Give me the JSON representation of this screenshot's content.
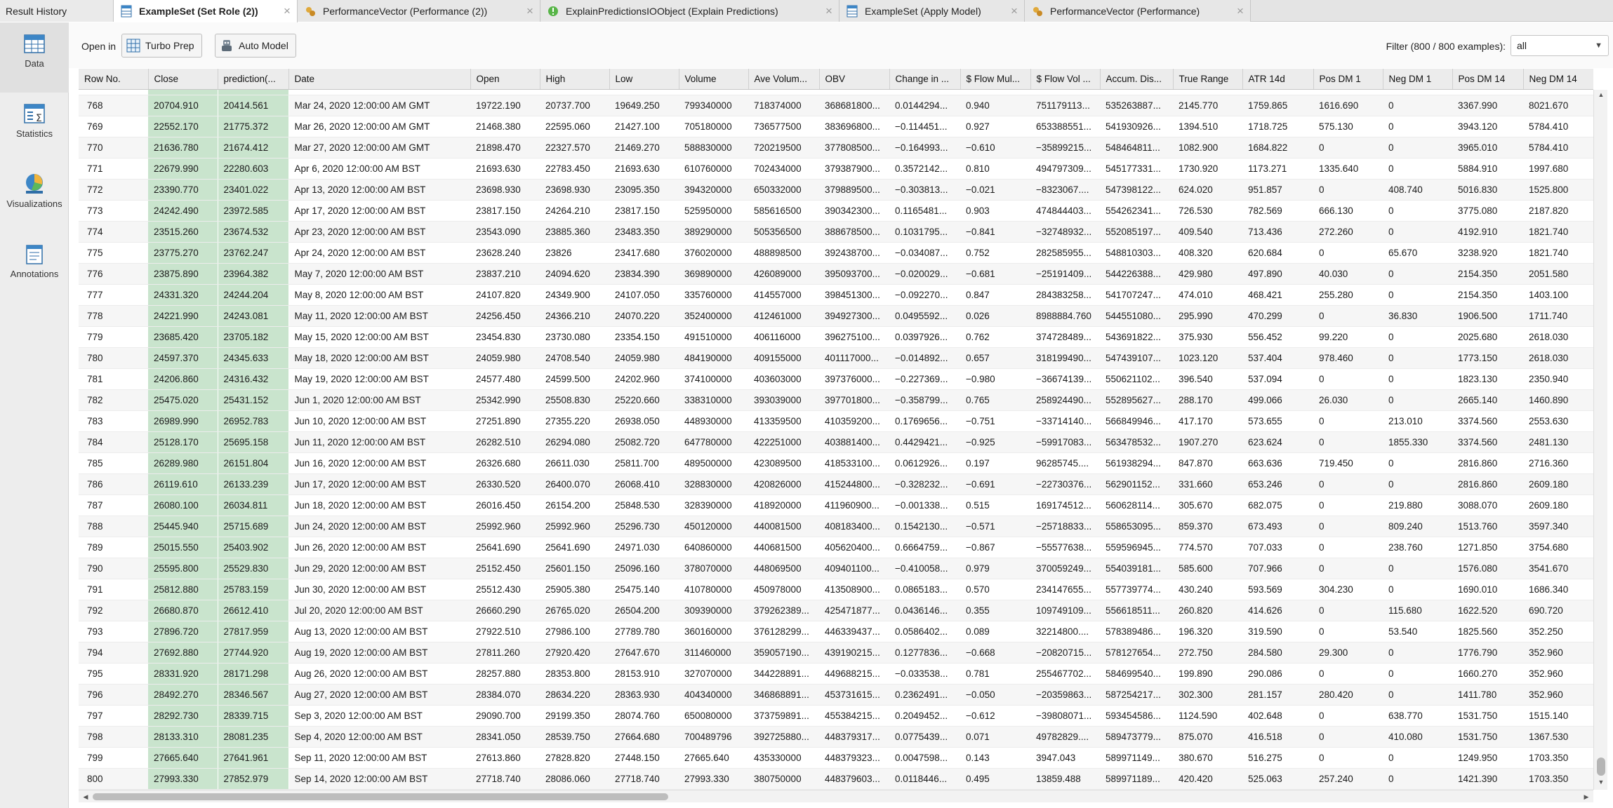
{
  "tabs": {
    "result_history": "Result History",
    "items": [
      {
        "label": "ExampleSet (Set Role (2))",
        "active": true,
        "icon": "exampleset-icon"
      },
      {
        "label": "PerformanceVector (Performance (2))",
        "active": false,
        "icon": "performance-icon"
      },
      {
        "label": "ExplainPredictionsIOObject (Explain Predictions)",
        "active": false,
        "icon": "explain-icon"
      },
      {
        "label": "ExampleSet (Apply Model)",
        "active": false,
        "icon": "exampleset-icon"
      },
      {
        "label": "PerformanceVector (Performance)",
        "active": false,
        "icon": "performance-icon"
      }
    ],
    "close_glyph": "×"
  },
  "nav": {
    "data": "Data",
    "statistics": "Statistics",
    "visualizations": "Visualizations",
    "annotations": "Annotations"
  },
  "toolbar": {
    "open_in": "Open in",
    "turbo_prep": "Turbo Prep",
    "auto_model": "Auto Model",
    "filter_label": "Filter (800 / 800 examples):",
    "filter_value": "all"
  },
  "table": {
    "columns": [
      "Row No.",
      "Close",
      "prediction(...",
      "Date",
      "Open",
      "High",
      "Low",
      "Volume",
      "Ave Volum...",
      "OBV",
      "Change in ...",
      "$ Flow Mul...",
      "$ Flow Vol ...",
      "Accum. Dis...",
      "True Range",
      "ATR 14d",
      "Pos DM 1",
      "Neg DM 1",
      "Pos DM 14",
      "Neg DM 14"
    ],
    "rows": [
      [
        "768",
        "20704.910",
        "20414.561",
        "Mar 24, 2020 12:00:00 AM GMT",
        "19722.190",
        "20737.700",
        "19649.250",
        "799340000",
        "718374000",
        "368681800...",
        "0.0144294...",
        "0.940",
        "751179113...",
        "535263887...",
        "2145.770",
        "1759.865",
        "1616.690",
        "0",
        "3367.990",
        "8021.670"
      ],
      [
        "769",
        "22552.170",
        "21775.372",
        "Mar 26, 2020 12:00:00 AM GMT",
        "21468.380",
        "22595.060",
        "21427.100",
        "705180000",
        "736577500",
        "383696800...",
        "−0.114451...",
        "0.927",
        "653388551...",
        "541930926...",
        "1394.510",
        "1718.725",
        "575.130",
        "0",
        "3943.120",
        "5784.410"
      ],
      [
        "770",
        "21636.780",
        "21674.412",
        "Mar 27, 2020 12:00:00 AM GMT",
        "21898.470",
        "22327.570",
        "21469.270",
        "588830000",
        "720219500",
        "377808500...",
        "−0.164993...",
        "−0.610",
        "−35899215...",
        "548464811...",
        "1082.900",
        "1684.822",
        "0",
        "0",
        "3965.010",
        "5784.410"
      ],
      [
        "771",
        "22679.990",
        "22280.603",
        "Apr 6, 2020 12:00:00 AM BST",
        "21693.630",
        "22783.450",
        "21693.630",
        "610760000",
        "702434000",
        "379387900...",
        "0.3572142...",
        "0.810",
        "494797309...",
        "545177331...",
        "1730.920",
        "1173.271",
        "1335.640",
        "0",
        "5884.910",
        "1997.680"
      ],
      [
        "772",
        "23390.770",
        "23401.022",
        "Apr 13, 2020 12:00:00 AM BST",
        "23698.930",
        "23698.930",
        "23095.350",
        "394320000",
        "650332000",
        "379889500...",
        "−0.303813...",
        "−0.021",
        "−8323067....",
        "547398122...",
        "624.020",
        "951.857",
        "0",
        "408.740",
        "5016.830",
        "1525.800"
      ],
      [
        "773",
        "24242.490",
        "23972.585",
        "Apr 17, 2020 12:00:00 AM BST",
        "23817.150",
        "24264.210",
        "23817.150",
        "525950000",
        "585616500",
        "390342300...",
        "0.1165481...",
        "0.903",
        "474844403...",
        "554262341...",
        "726.530",
        "782.569",
        "666.130",
        "0",
        "3775.080",
        "2187.820"
      ],
      [
        "774",
        "23515.260",
        "23674.532",
        "Apr 23, 2020 12:00:00 AM BST",
        "23543.090",
        "23885.360",
        "23483.350",
        "389290000",
        "505356500",
        "388678500...",
        "0.1031795...",
        "−0.841",
        "−32748932...",
        "552085197...",
        "409.540",
        "713.436",
        "272.260",
        "0",
        "4192.910",
        "1821.740"
      ],
      [
        "775",
        "23775.270",
        "23762.247",
        "Apr 24, 2020 12:00:00 AM BST",
        "23628.240",
        "23826",
        "23417.680",
        "376020000",
        "488898500",
        "392438700...",
        "−0.034087...",
        "0.752",
        "282585955...",
        "548810303...",
        "408.320",
        "620.684",
        "0",
        "65.670",
        "3238.920",
        "1821.740"
      ],
      [
        "776",
        "23875.890",
        "23964.382",
        "May 7, 2020 12:00:00 AM BST",
        "23837.210",
        "24094.620",
        "23834.390",
        "369890000",
        "426089000",
        "395093700...",
        "−0.020029...",
        "−0.681",
        "−25191409...",
        "544226388...",
        "429.980",
        "497.890",
        "40.030",
        "0",
        "2154.350",
        "2051.580"
      ],
      [
        "777",
        "24331.320",
        "24244.204",
        "May 8, 2020 12:00:00 AM BST",
        "24107.820",
        "24349.900",
        "24107.050",
        "335760000",
        "414557000",
        "398451300...",
        "−0.092270...",
        "0.847",
        "284383258...",
        "541707247...",
        "474.010",
        "468.421",
        "255.280",
        "0",
        "2154.350",
        "1403.100"
      ],
      [
        "778",
        "24221.990",
        "24243.081",
        "May 11, 2020 12:00:00 AM BST",
        "24256.450",
        "24366.210",
        "24070.220",
        "352400000",
        "412461000",
        "394927300...",
        "0.0495592...",
        "0.026",
        "8988884.760",
        "544551080...",
        "295.990",
        "470.299",
        "0",
        "36.830",
        "1906.500",
        "1711.740"
      ],
      [
        "779",
        "23685.420",
        "23705.182",
        "May 15, 2020 12:00:00 AM BST",
        "23454.830",
        "23730.080",
        "23354.150",
        "491510000",
        "406116000",
        "396275100...",
        "0.0397926...",
        "0.762",
        "374728489...",
        "543691822...",
        "375.930",
        "556.452",
        "99.220",
        "0",
        "2025.680",
        "2618.030"
      ],
      [
        "780",
        "24597.370",
        "24345.633",
        "May 18, 2020 12:00:00 AM BST",
        "24059.980",
        "24708.540",
        "24059.980",
        "484190000",
        "409155000",
        "401117000...",
        "−0.014892...",
        "0.657",
        "318199490...",
        "547439107...",
        "1023.120",
        "537.404",
        "978.460",
        "0",
        "1773.150",
        "2618.030"
      ],
      [
        "781",
        "24206.860",
        "24316.432",
        "May 19, 2020 12:00:00 AM BST",
        "24577.480",
        "24599.500",
        "24202.960",
        "374100000",
        "403603000",
        "397376000...",
        "−0.227369...",
        "−0.980",
        "−36674139...",
        "550621102...",
        "396.540",
        "537.094",
        "0",
        "0",
        "1823.130",
        "2350.940"
      ],
      [
        "782",
        "25475.020",
        "25431.152",
        "Jun 1, 2020 12:00:00 AM BST",
        "25342.990",
        "25508.830",
        "25220.660",
        "338310000",
        "393039000",
        "397701800...",
        "−0.358799...",
        "0.765",
        "258924490...",
        "552895627...",
        "288.170",
        "499.066",
        "26.030",
        "0",
        "2665.140",
        "1460.890"
      ],
      [
        "783",
        "26989.990",
        "26952.783",
        "Jun 10, 2020 12:00:00 AM BST",
        "27251.890",
        "27355.220",
        "26938.050",
        "448930000",
        "413359500",
        "410359200...",
        "0.1769656...",
        "−0.751",
        "−33714140...",
        "566849946...",
        "417.170",
        "573.655",
        "0",
        "213.010",
        "3374.560",
        "2553.630"
      ],
      [
        "784",
        "25128.170",
        "25695.158",
        "Jun 11, 2020 12:00:00 AM BST",
        "26282.510",
        "26294.080",
        "25082.720",
        "647780000",
        "422251000",
        "403881400...",
        "0.4429421...",
        "−0.925",
        "−59917083...",
        "563478532...",
        "1907.270",
        "623.624",
        "0",
        "1855.330",
        "3374.560",
        "2481.130"
      ],
      [
        "785",
        "26289.980",
        "26151.804",
        "Jun 16, 2020 12:00:00 AM BST",
        "26326.680",
        "26611.030",
        "25811.700",
        "489500000",
        "423089500",
        "418533100...",
        "0.0612926...",
        "0.197",
        "96285745....",
        "561938294...",
        "847.870",
        "663.636",
        "719.450",
        "0",
        "2816.860",
        "2716.360"
      ],
      [
        "786",
        "26119.610",
        "26133.239",
        "Jun 17, 2020 12:00:00 AM BST",
        "26330.520",
        "26400.070",
        "26068.410",
        "328830000",
        "420826000",
        "415244800...",
        "−0.328232...",
        "−0.691",
        "−22730376...",
        "562901152...",
        "331.660",
        "653.246",
        "0",
        "0",
        "2816.860",
        "2609.180"
      ],
      [
        "787",
        "26080.100",
        "26034.811",
        "Jun 18, 2020 12:00:00 AM BST",
        "26016.450",
        "26154.200",
        "25848.530",
        "328390000",
        "418920000",
        "411960900...",
        "−0.001338...",
        "0.515",
        "169174512...",
        "560628114...",
        "305.670",
        "682.075",
        "0",
        "219.880",
        "3088.070",
        "2609.180"
      ],
      [
        "788",
        "25445.940",
        "25715.689",
        "Jun 24, 2020 12:00:00 AM BST",
        "25992.960",
        "25992.960",
        "25296.730",
        "450120000",
        "440081500",
        "408183400...",
        "0.1542130...",
        "−0.571",
        "−25718833...",
        "558653095...",
        "859.370",
        "673.493",
        "0",
        "809.240",
        "1513.760",
        "3597.340"
      ],
      [
        "789",
        "25015.550",
        "25403.902",
        "Jun 26, 2020 12:00:00 AM BST",
        "25641.690",
        "25641.690",
        "24971.030",
        "640860000",
        "440681500",
        "405620400...",
        "0.6664759...",
        "−0.867",
        "−55577638...",
        "559596945...",
        "774.570",
        "707.033",
        "0",
        "238.760",
        "1271.850",
        "3754.680"
      ],
      [
        "790",
        "25595.800",
        "25529.830",
        "Jun 29, 2020 12:00:00 AM BST",
        "25152.450",
        "25601.150",
        "25096.160",
        "378070000",
        "448069500",
        "409401100...",
        "−0.410058...",
        "0.979",
        "370059249...",
        "554039181...",
        "585.600",
        "707.966",
        "0",
        "0",
        "1576.080",
        "3541.670"
      ],
      [
        "791",
        "25812.880",
        "25783.159",
        "Jun 30, 2020 12:00:00 AM BST",
        "25512.430",
        "25905.380",
        "25475.140",
        "410780000",
        "450978000",
        "413508900...",
        "0.0865183...",
        "0.570",
        "234147655...",
        "557739774...",
        "430.240",
        "593.569",
        "304.230",
        "0",
        "1690.010",
        "1686.340"
      ],
      [
        "792",
        "26680.870",
        "26612.410",
        "Jul 20, 2020 12:00:00 AM BST",
        "26660.290",
        "26765.020",
        "26504.200",
        "309390000",
        "379262389...",
        "425471877...",
        "0.0436146...",
        "0.355",
        "109749109...",
        "556618511...",
        "260.820",
        "414.626",
        "0",
        "115.680",
        "1622.520",
        "690.720"
      ],
      [
        "793",
        "27896.720",
        "27817.959",
        "Aug 13, 2020 12:00:00 AM BST",
        "27922.510",
        "27986.100",
        "27789.780",
        "360160000",
        "376128299...",
        "446339437...",
        "0.0586402...",
        "0.089",
        "32214800....",
        "578389486...",
        "196.320",
        "319.590",
        "0",
        "53.540",
        "1825.560",
        "352.250"
      ],
      [
        "794",
        "27692.880",
        "27744.920",
        "Aug 19, 2020 12:00:00 AM BST",
        "27811.260",
        "27920.420",
        "27647.670",
        "311460000",
        "359057190...",
        "439190215...",
        "0.1277836...",
        "−0.668",
        "−20820715...",
        "578127654...",
        "272.750",
        "284.580",
        "29.300",
        "0",
        "1776.790",
        "352.960"
      ],
      [
        "795",
        "28331.920",
        "28171.298",
        "Aug 26, 2020 12:00:00 AM BST",
        "28257.880",
        "28353.800",
        "28153.910",
        "327070000",
        "344228891...",
        "449688215...",
        "−0.033538...",
        "0.781",
        "255467702...",
        "584699540...",
        "199.890",
        "290.086",
        "0",
        "0",
        "1660.270",
        "352.960"
      ],
      [
        "796",
        "28492.270",
        "28346.567",
        "Aug 27, 2020 12:00:00 AM BST",
        "28384.070",
        "28634.220",
        "28363.930",
        "404340000",
        "346868891...",
        "453731615...",
        "0.2362491...",
        "−0.050",
        "−20359863...",
        "587254217...",
        "302.300",
        "281.157",
        "280.420",
        "0",
        "1411.780",
        "352.960"
      ],
      [
        "797",
        "28292.730",
        "28339.715",
        "Sep 3, 2020 12:00:00 AM BST",
        "29090.700",
        "29199.350",
        "28074.760",
        "650080000",
        "373759891...",
        "455384215...",
        "0.2049452...",
        "−0.612",
        "−39808071...",
        "593454586...",
        "1124.590",
        "402.648",
        "0",
        "638.770",
        "1531.750",
        "1515.140"
      ],
      [
        "798",
        "28133.310",
        "28081.235",
        "Sep 4, 2020 12:00:00 AM BST",
        "28341.050",
        "28539.750",
        "27664.680",
        "700489796",
        "392725880...",
        "448379317...",
        "0.0775439...",
        "0.071",
        "49782829....",
        "589473779...",
        "875.070",
        "416.518",
        "0",
        "410.080",
        "1531.750",
        "1367.530"
      ],
      [
        "799",
        "27665.640",
        "27641.961",
        "Sep 11, 2020 12:00:00 AM BST",
        "27613.860",
        "27828.820",
        "27448.150",
        "27665.640",
        "435330000",
        "448379323...",
        "0.0047598...",
        "0.143",
        "3947.043",
        "589971149...",
        "380.670",
        "516.275",
        "0",
        "0",
        "1249.950",
        "1703.350"
      ],
      [
        "800",
        "27993.330",
        "27852.979",
        "Sep 14, 2020 12:00:00 AM BST",
        "27718.740",
        "28086.060",
        "27718.740",
        "27993.330",
        "380750000",
        "448379603...",
        "0.0118446...",
        "0.495",
        "13859.488",
        "589971189...",
        "420.420",
        "525.063",
        "257.240",
        "0",
        "1421.390",
        "1703.350"
      ]
    ]
  },
  "colors": {
    "special_column_bg": "#c9e4cd",
    "header_bg": "#ececec",
    "stripe_bg": "#f6f6f6"
  }
}
